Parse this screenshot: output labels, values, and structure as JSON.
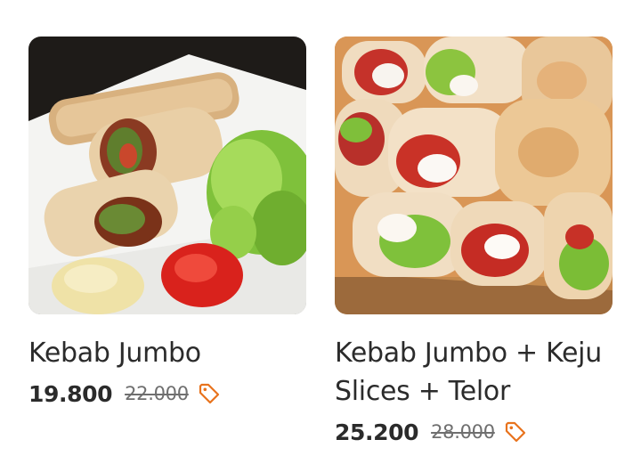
{
  "products": [
    {
      "name": "Kebab Jumbo",
      "price": "19.800",
      "original_price": "22.000",
      "image_icon": "kebab-plate-photo",
      "discount_icon": "price-tag-icon"
    },
    {
      "name": "Kebab Jumbo + Keju Slices + Telor",
      "price": "25.200",
      "original_price": "28.000",
      "image_icon": "kebab-board-photo",
      "discount_icon": "price-tag-icon"
    }
  ],
  "colors": {
    "text": "#2b2b2b",
    "strikethrough": "#6f6f6f",
    "discount_tag": "#e8731d"
  }
}
